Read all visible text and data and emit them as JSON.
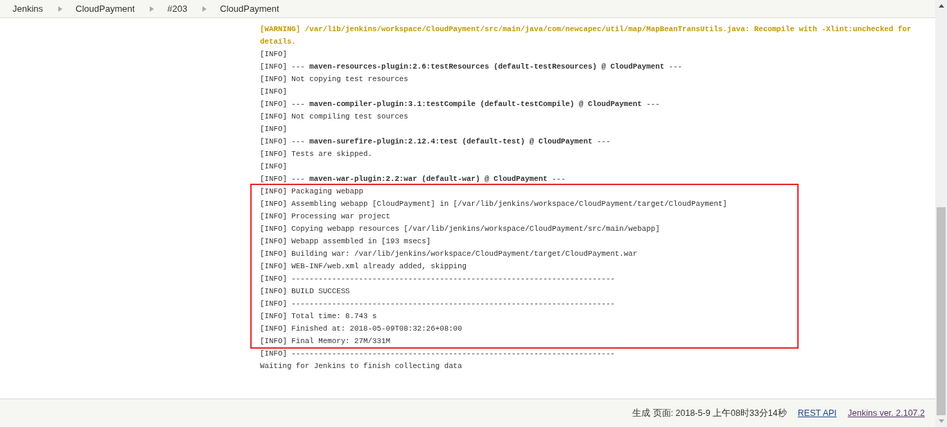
{
  "breadcrumbs": [
    {
      "label": "Jenkins"
    },
    {
      "label": "CloudPayment"
    },
    {
      "label": "#203"
    },
    {
      "label": "CloudPayment"
    }
  ],
  "console": {
    "lines": [
      {
        "kind": "warning",
        "text": "[WARNING] /var/lib/jenkins/workspace/CloudPayment/src/main/java/com/newcapec/util/map/MapBeanTransUtils.java: Recompile with -Xlint:unchecked for details.",
        "highlighted": false
      },
      {
        "kind": "info",
        "text": "[INFO]",
        "highlighted": false
      },
      {
        "kind": "info",
        "text": "[INFO] --- **maven-resources-plugin:2.6:testResources (default-testResources) @ CloudPayment** ---",
        "highlighted": false
      },
      {
        "kind": "info",
        "text": "[INFO] Not copying test resources",
        "highlighted": false
      },
      {
        "kind": "info",
        "text": "[INFO]",
        "highlighted": false
      },
      {
        "kind": "info",
        "text": "[INFO] --- **maven-compiler-plugin:3.1:testCompile (default-testCompile) @ CloudPayment** ---",
        "highlighted": false
      },
      {
        "kind": "info",
        "text": "[INFO] Not compiling test sources",
        "highlighted": false
      },
      {
        "kind": "info",
        "text": "[INFO]",
        "highlighted": false
      },
      {
        "kind": "info",
        "text": "[INFO] --- **maven-surefire-plugin:2.12.4:test (default-test) @ CloudPayment** ---",
        "highlighted": false
      },
      {
        "kind": "info",
        "text": "[INFO] Tests are skipped.",
        "highlighted": false
      },
      {
        "kind": "info",
        "text": "[INFO]",
        "highlighted": false
      },
      {
        "kind": "info",
        "text": "[INFO] --- **maven-war-plugin:2.2:war (default-war) @ CloudPayment** ---",
        "highlighted": false
      },
      {
        "kind": "info",
        "text": "[INFO] Packaging webapp",
        "highlighted": true
      },
      {
        "kind": "info",
        "text": "[INFO] Assembling webapp [CloudPayment] in [/var/lib/jenkins/workspace/CloudPayment/target/CloudPayment]",
        "highlighted": true
      },
      {
        "kind": "info",
        "text": "[INFO] Processing war project",
        "highlighted": true
      },
      {
        "kind": "info",
        "text": "[INFO] Copying webapp resources [/var/lib/jenkins/workspace/CloudPayment/src/main/webapp]",
        "highlighted": true
      },
      {
        "kind": "info",
        "text": "[INFO] Webapp assembled in [193 msecs]",
        "highlighted": true
      },
      {
        "kind": "info",
        "text": "[INFO] Building war: /var/lib/jenkins/workspace/CloudPayment/target/CloudPayment.war",
        "highlighted": true
      },
      {
        "kind": "info",
        "text": "[INFO] WEB-INF/web.xml already added, skipping",
        "highlighted": true
      },
      {
        "kind": "info",
        "text": "[INFO] ------------------------------------------------------------------------",
        "highlighted": true
      },
      {
        "kind": "info",
        "text": "[INFO] BUILD SUCCESS",
        "highlighted": true
      },
      {
        "kind": "info",
        "text": "[INFO] ------------------------------------------------------------------------",
        "highlighted": true
      },
      {
        "kind": "info",
        "text": "[INFO] Total time: 8.743 s",
        "highlighted": true
      },
      {
        "kind": "info",
        "text": "[INFO] Finished at: 2018-05-09T08:32:26+08:00",
        "highlighted": true
      },
      {
        "kind": "info",
        "text": "[INFO] Final Memory: 27M/331M",
        "highlighted": true
      },
      {
        "kind": "info",
        "text": "[INFO] ------------------------------------------------------------------------",
        "highlighted": false
      },
      {
        "kind": "info",
        "text": "Waiting for Jenkins to finish collecting data",
        "highlighted": false
      }
    ]
  },
  "footer": {
    "generated": "生成 页面: 2018-5-9 上午08时33分14秒",
    "links": [
      {
        "label": "REST API",
        "visited": false
      },
      {
        "label": "Jenkins ver. 2.107.2",
        "visited": true
      }
    ]
  }
}
